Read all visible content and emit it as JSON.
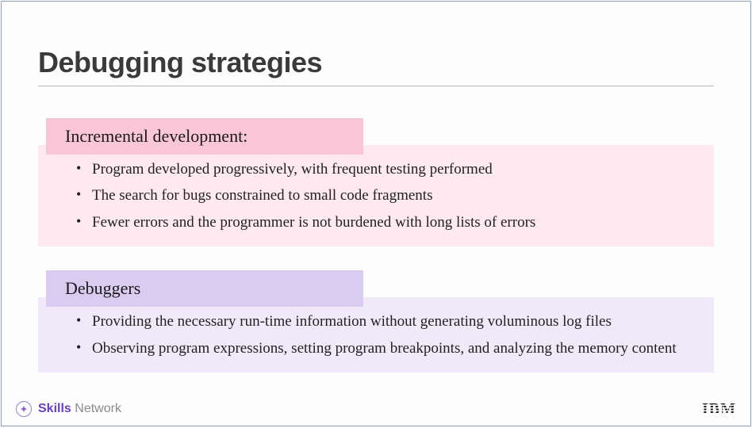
{
  "title": "Debugging strategies",
  "sections": [
    {
      "header": "Incremental development:",
      "color": "pink",
      "items": [
        "Program developed progressively, with frequent testing performed",
        "The search for bugs constrained to small code fragments",
        "Fewer errors and the programmer is not burdened with long lists of errors"
      ]
    },
    {
      "header": "Debuggers",
      "color": "purple",
      "items": [
        "Providing the necessary run-time information without generating voluminous log files",
        "Observing program expressions, setting program breakpoints, and analyzing the memory content"
      ]
    }
  ],
  "footer": {
    "skills_bold": "Skills",
    "skills_light": " Network",
    "company": "IBM"
  }
}
